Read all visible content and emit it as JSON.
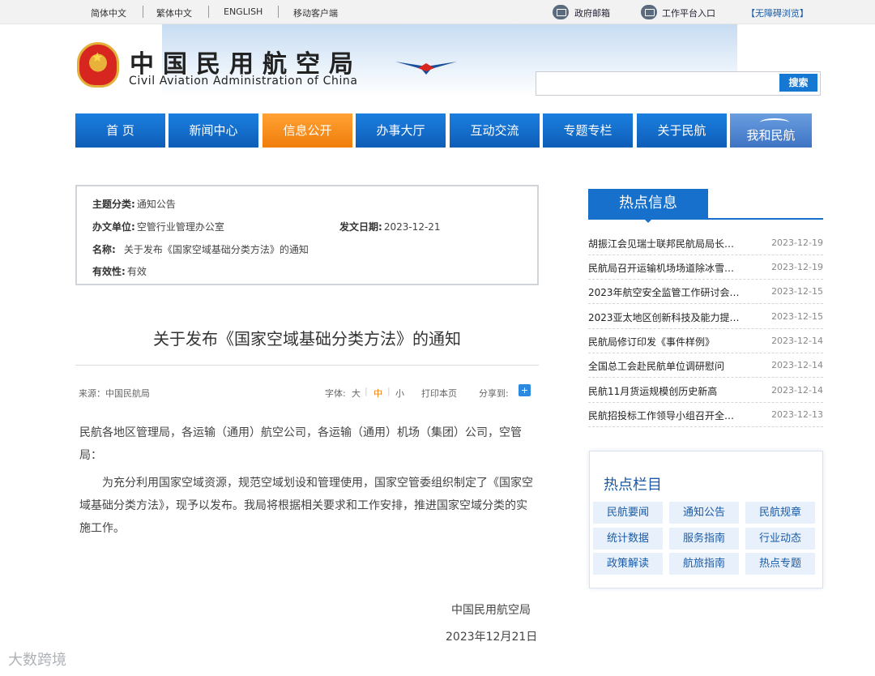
{
  "topbar": {
    "simplified": "简体中文",
    "traditional": "繁体中文",
    "english": "ENGLISH",
    "mobile": "移动客户端",
    "gov_mail": "政府邮箱",
    "work_platform": "工作平台入口",
    "accessible": "【无障碍浏览】"
  },
  "header": {
    "title_cn": "中国民用航空局",
    "title_en": "Civil Aviation Administration of China",
    "search_placeholder": "",
    "search_button": "搜索"
  },
  "nav": {
    "items": [
      "首 页",
      "新闻中心",
      "信息公开",
      "办事大厅",
      "互动交流",
      "专题专栏",
      "关于民航",
      "我和民航"
    ],
    "active_index": 2,
    "active_color": "#f07d0c",
    "base_color": "#0e5db7"
  },
  "info": {
    "subject_label": "主题分类:",
    "subject_value": "通知公告",
    "office_label": "办文单位:",
    "office_value": "空管行业管理办公室",
    "date_label": "发文日期:",
    "date_value": "2023-12-21",
    "name_label": "名称:",
    "name_value": "关于发布《国家空域基础分类方法》的通知",
    "validity_label": "有效性:",
    "validity_value": "有效"
  },
  "article": {
    "title": "关于发布《国家空域基础分类方法》的通知",
    "source": "来源：中国民航局",
    "font_label": "字体:",
    "font_large": "大",
    "font_medium": "中",
    "font_small": "小",
    "print": "打印本页",
    "share": "分享到:",
    "greeting": "民航各地区管理局，各运输（通用）航空公司，各运输（通用）机场（集团）公司，空管局：",
    "paragraph": "为充分利用国家空域资源，规范空域划设和管理使用，国家空管委组织制定了《国家空域基础分类方法》，现予以发布。我局将根据相关要求和工作安排，推进国家空域分类的实施工作。",
    "signature": "中国民用航空局",
    "sign_date": "2023年12月21日"
  },
  "hot_info": {
    "title": "热点信息",
    "items": [
      {
        "title": "胡振江会见瑞士联邦民航局局长…",
        "date": "2023-12-19"
      },
      {
        "title": "民航局召开运输机场场道除冰雪…",
        "date": "2023-12-19"
      },
      {
        "title": "2023年航空安全监管工作研讨会…",
        "date": "2023-12-15"
      },
      {
        "title": "2023亚太地区创新科技及能力提…",
        "date": "2023-12-15"
      },
      {
        "title": "民航局修订印发《事件样例》",
        "date": "2023-12-14"
      },
      {
        "title": "全国总工会赴民航单位调研慰问",
        "date": "2023-12-14"
      },
      {
        "title": "民航11月货运规模创历史新高",
        "date": "2023-12-14"
      },
      {
        "title": "民航招投标工作领导小组召开全…",
        "date": "2023-12-13"
      }
    ]
  },
  "hot_columns": {
    "title": "热点栏目",
    "items": [
      "民航要闻",
      "通知公告",
      "民航规章",
      "统计数据",
      "服务指南",
      "行业动态",
      "政策解读",
      "航旅指南",
      "热点专题"
    ]
  },
  "watermark": "大数跨境"
}
